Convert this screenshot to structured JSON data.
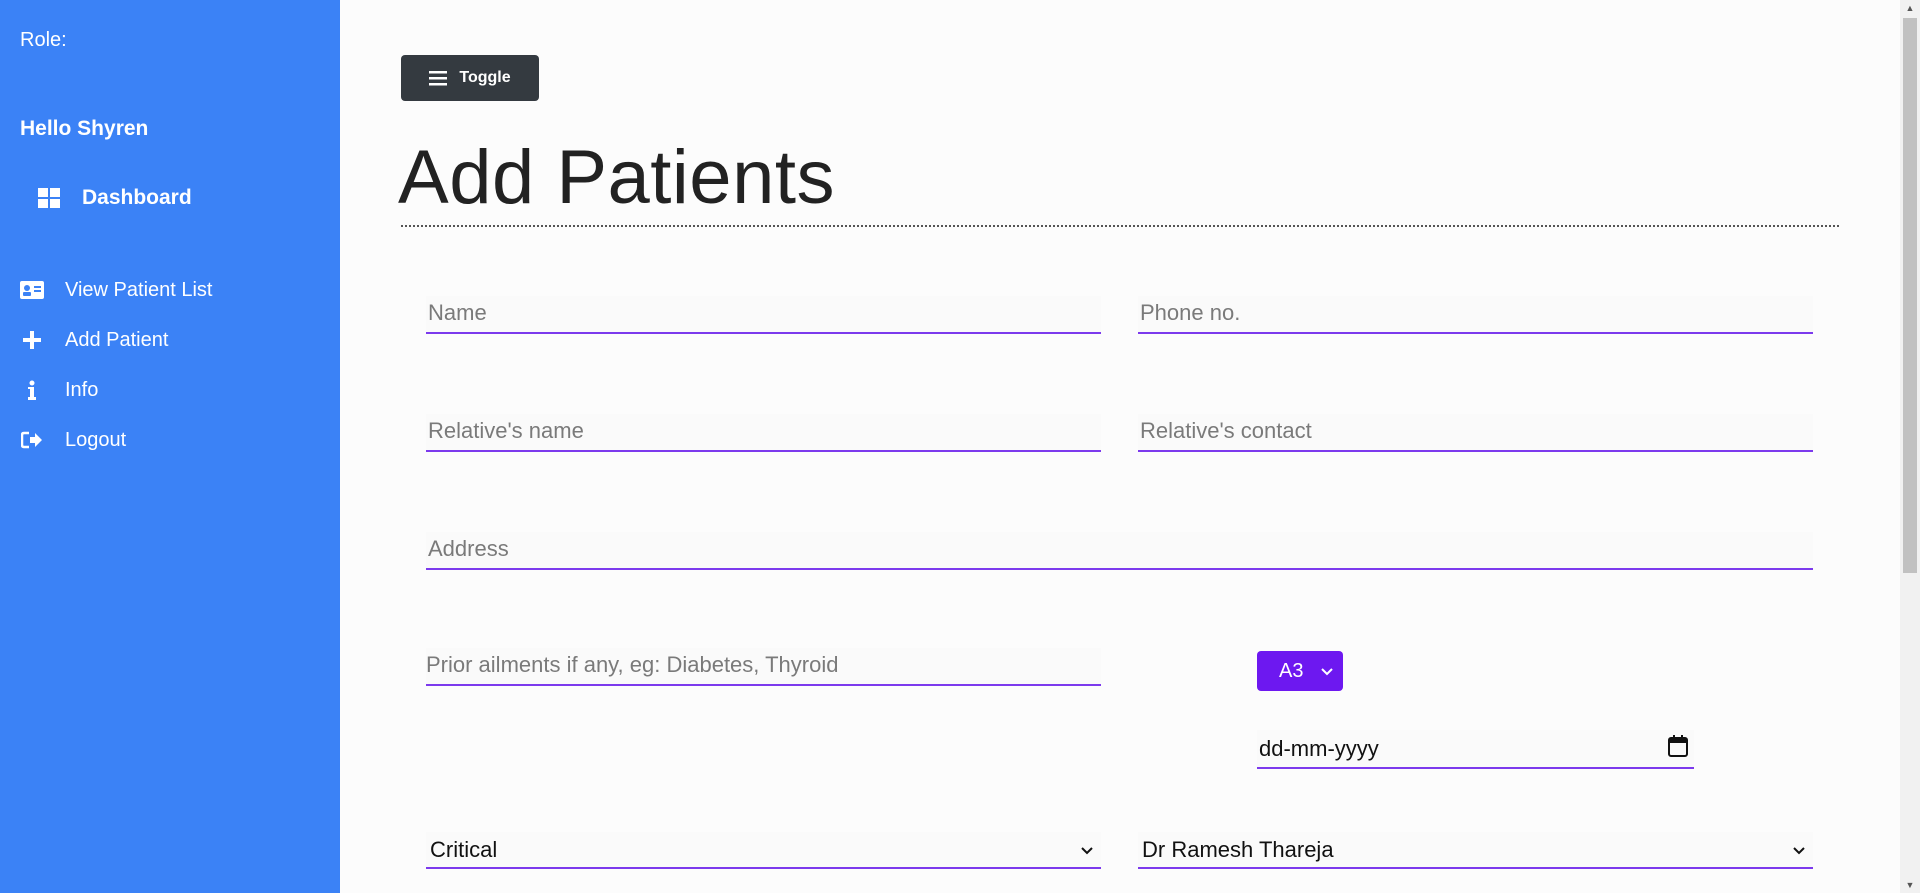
{
  "sidebar": {
    "role_label": "Role:",
    "greeting": "Hello Shyren",
    "dashboard": {
      "label": "Dashboard",
      "icon": "dashboard-grid-icon"
    },
    "items": [
      {
        "label": "View Patient List",
        "icon": "id-card-icon"
      },
      {
        "label": "Add Patient",
        "icon": "plus-icon"
      },
      {
        "label": "Info",
        "icon": "info-icon"
      },
      {
        "label": "Logout",
        "icon": "logout-icon"
      }
    ]
  },
  "toolbar": {
    "toggle_label": "Toggle",
    "toggle_icon": "hamburger-icon"
  },
  "page": {
    "title": "Add Patients"
  },
  "form": {
    "name_placeholder": "Name",
    "phone_placeholder": "Phone no.",
    "relative_name_placeholder": "Relative's name",
    "relative_contact_placeholder": "Relative's contact",
    "address_placeholder": "Address",
    "ailments_placeholder": "Prior ailments if any, eg: Diabetes, Thyroid",
    "blood_group_value": "A3",
    "date_placeholder": "dd-mm-yyyy",
    "condition_value": "Critical",
    "doctor_value": "Dr Ramesh Thareja"
  },
  "colors": {
    "sidebar_bg": "#3b82f6",
    "accent": "#7c3aed",
    "button_dark": "#343a40",
    "blood_button": "#6d18f0"
  }
}
